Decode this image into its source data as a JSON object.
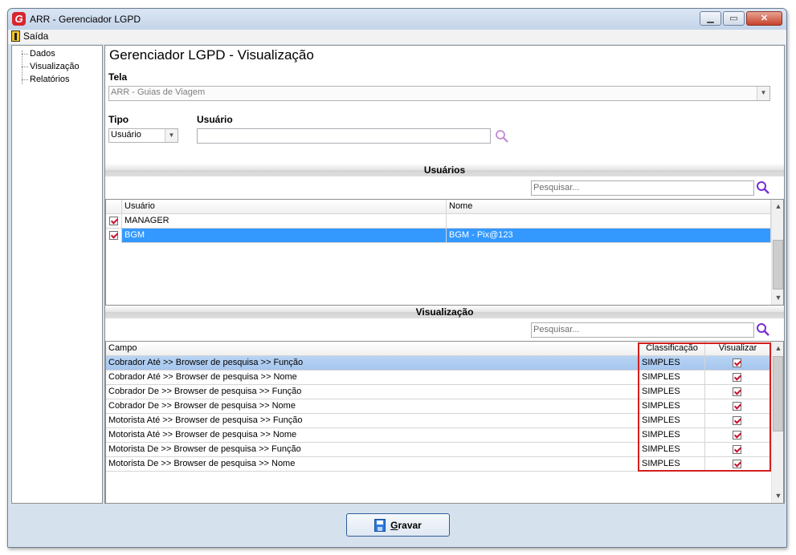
{
  "window": {
    "title": "ARR - Gerenciador LGPD",
    "logo_letter": "G"
  },
  "menu": {
    "exit_label": "Saída"
  },
  "tree": {
    "items": [
      "Dados",
      "Visualização",
      "Relatórios"
    ]
  },
  "page": {
    "title": "Gerenciador LGPD - Visualização"
  },
  "form": {
    "tela_label": "Tela",
    "tela_value": "ARR - Guias de Viagem",
    "tipo_label": "Tipo",
    "tipo_value": "Usuário",
    "usuario_label": "Usuário",
    "usuario_value": ""
  },
  "users_section": {
    "title": "Usuários",
    "search_placeholder": "Pesquisar...",
    "columns": [
      "Usuário",
      "Nome"
    ],
    "rows": [
      {
        "checked": true,
        "usuario": "MANAGER",
        "nome": "",
        "selected": false
      },
      {
        "checked": true,
        "usuario": "BGM",
        "nome": "BGM - Pix@123",
        "selected": true
      }
    ]
  },
  "view_section": {
    "title": "Visualização",
    "search_placeholder": "Pesquisar...",
    "columns": [
      "Campo",
      "Classificação",
      "Visualizar"
    ],
    "rows": [
      {
        "campo": "Cobrador Até >> Browser de pesquisa >> Função",
        "classificacao": "SIMPLES",
        "visualizar": true
      },
      {
        "campo": "Cobrador Até >> Browser de pesquisa >> Nome",
        "classificacao": "SIMPLES",
        "visualizar": true
      },
      {
        "campo": "Cobrador De >> Browser de pesquisa >> Função",
        "classificacao": "SIMPLES",
        "visualizar": true
      },
      {
        "campo": "Cobrador De >> Browser de pesquisa >> Nome",
        "classificacao": "SIMPLES",
        "visualizar": true
      },
      {
        "campo": "Motorista Até >> Browser de pesquisa >> Função",
        "classificacao": "SIMPLES",
        "visualizar": true
      },
      {
        "campo": "Motorista Até >> Browser de pesquisa >> Nome",
        "classificacao": "SIMPLES",
        "visualizar": true
      },
      {
        "campo": "Motorista De >> Browser de pesquisa >> Função",
        "classificacao": "SIMPLES",
        "visualizar": true
      },
      {
        "campo": "Motorista De >> Browser de pesquisa >> Nome",
        "classificacao": "SIMPLES",
        "visualizar": true
      }
    ]
  },
  "footer": {
    "save_label": "Gravar",
    "save_hotkey": "G",
    "save_rest": "ravar"
  },
  "colors": {
    "selection": "#3399ff",
    "highlight_box": "#d22020",
    "search_icon": "#7a2bd6"
  }
}
